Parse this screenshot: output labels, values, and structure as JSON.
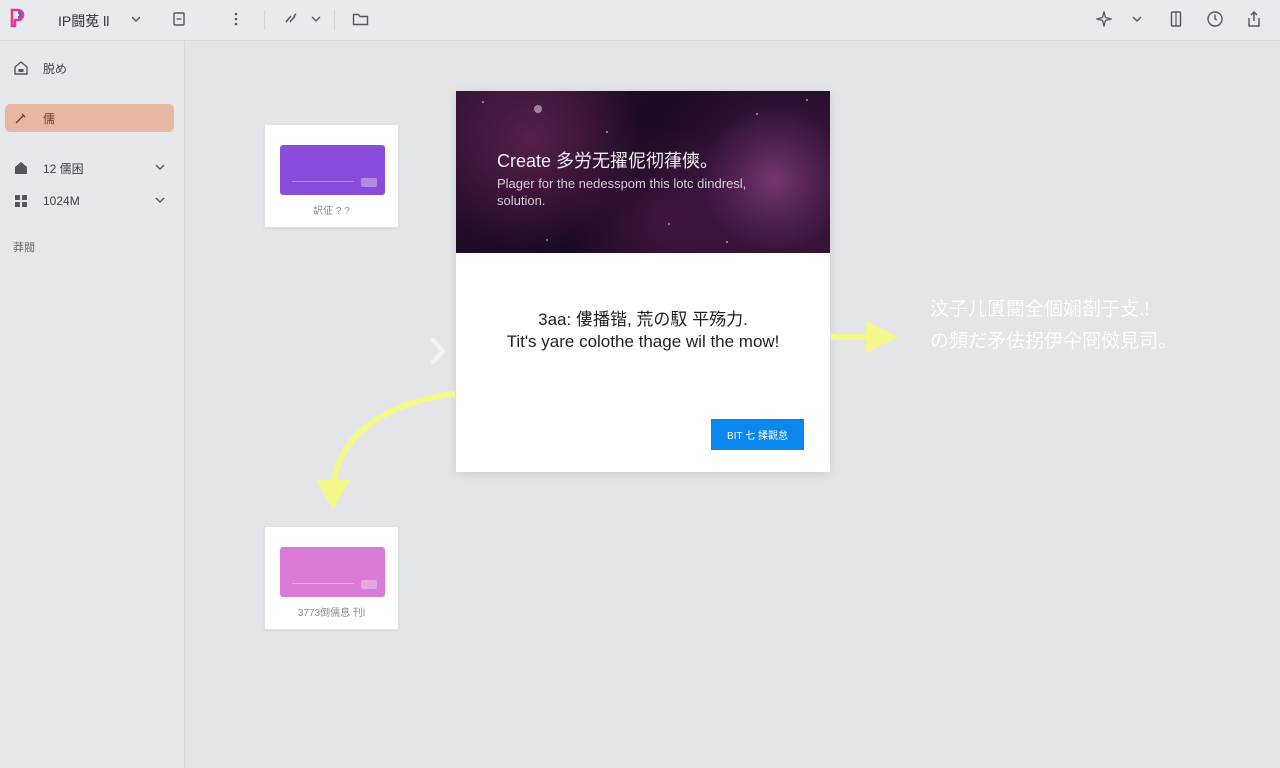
{
  "toolbar": {
    "title": "IP闘莬 ll",
    "icons": [
      "logo-icon",
      "chevron-down-icon",
      "save-icon",
      "more-vertical-icon",
      "redo-icon",
      "folder-icon",
      "sparkle-icon",
      "panel-icon",
      "clock-icon",
      "share-icon"
    ]
  },
  "colors": {
    "logo_left": "#e5388f",
    "logo_right": "#6b4de6",
    "sidebar_active": "#e8b7a4",
    "cta": "#0b87f0",
    "arrow": "#f6f78a",
    "card1_thumb": "#8a4ddb",
    "card2_thumb": "#d97ad6"
  },
  "sidebar": {
    "items": [
      {
        "label": "脱め"
      },
      {
        "label": "儒"
      },
      {
        "label": "12 儒困"
      },
      {
        "label": "1024M"
      }
    ],
    "section_label": "莽閥"
  },
  "cards": [
    {
      "caption": "訳佂 ? ?"
    },
    {
      "caption": "3773倒儒息 刊l"
    }
  ],
  "dialog": {
    "title": "Create 多労无擢伲彻葎傸。",
    "subtitle": "Plager for the nedesspom this lotc dindresl, solution.",
    "line1": "3aa: 僂播锴, 荒の馭 平殇力.",
    "line2": "Tit's yare colothe thage wil the mow!",
    "cta_label": "BIT 七 揉觀怠"
  },
  "annotation": {
    "line1": "汶子儿匱閱全個娴剳于攴.!",
    "line2": "の頻だ矛佉拐伊仐冏傚見司。"
  }
}
